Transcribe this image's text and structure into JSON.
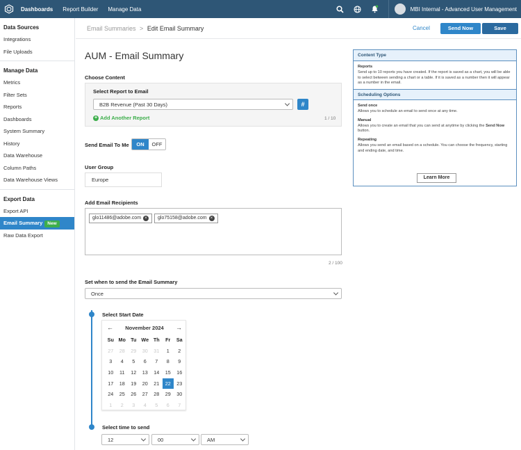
{
  "topbar": {
    "nav": [
      "Dashboards",
      "Report Builder",
      "Manage Data"
    ],
    "account_name": "MBI Internal - Advanced User Management"
  },
  "sidebar": {
    "section_data_sources": "Data Sources",
    "data_sources_items": [
      "Integrations",
      "File Uploads"
    ],
    "section_manage_data": "Manage Data",
    "manage_data_items": [
      "Metrics",
      "Filter Sets",
      "Reports",
      "Dashboards",
      "System Summary",
      "History",
      "Data Warehouse",
      "Column Paths",
      "Data Warehouse Views"
    ],
    "section_export_data": "Export Data",
    "export_data_items": [
      "Export API",
      "Email Summary",
      "Raw Data Export"
    ],
    "new_badge": "New"
  },
  "header": {
    "breadcrumb_parent": "Email Summaries",
    "breadcrumb_sep": ">",
    "breadcrumb_current": "Edit Email Summary",
    "cancel": "Cancel",
    "send_now": "Send Now",
    "save": "Save"
  },
  "form": {
    "title": "AUM - Email Summary",
    "choose_content": "Choose Content",
    "select_report_label": "Select Report to Email",
    "selected_report": "B2B Revenue (Past 30 Days)",
    "hash_button": "#",
    "add_another_report": "Add Another Report",
    "report_counter": "1 / 10",
    "send_email_to_me": "Send Email To Me",
    "toggle_on": "ON",
    "toggle_off": "OFF",
    "user_group_label": "User Group",
    "user_group_value": "Europe",
    "recipients_label": "Add Email Recipients",
    "recipients": [
      "glo11486@adobe.com",
      "glo75158@adobe.com"
    ],
    "recipients_counter": "2 / 100",
    "schedule_label": "Set when to send the Email Summary",
    "schedule_value": "Once",
    "start_date_label": "Select Start Date",
    "time_label": "Select time to send",
    "hour": "12",
    "minute": "00",
    "ampm": "AM"
  },
  "calendar": {
    "month": "November 2024",
    "prev": "←",
    "next": "→",
    "dow": [
      "Su",
      "Mo",
      "Tu",
      "We",
      "Th",
      "Fr",
      "Sa"
    ],
    "weeks": [
      [
        "27",
        "28",
        "29",
        "30",
        "31",
        "1",
        "2"
      ],
      [
        "3",
        "4",
        "5",
        "6",
        "7",
        "8",
        "9"
      ],
      [
        "10",
        "11",
        "12",
        "13",
        "14",
        "15",
        "16"
      ],
      [
        "17",
        "18",
        "19",
        "20",
        "21",
        "22",
        "23"
      ],
      [
        "24",
        "25",
        "26",
        "27",
        "28",
        "29",
        "30"
      ],
      [
        "1",
        "2",
        "3",
        "4",
        "5",
        "6",
        "7"
      ]
    ],
    "selected_day": "22"
  },
  "info": {
    "content_type_title": "Content Type",
    "reports_title": "Reports",
    "reports_text": "Send up to 10 reports you have created. If the report is saved as a chart, you will be able to select between sending a chart or a table. If it is saved as a number then it will appear as a number in the email.",
    "scheduling_title": "Scheduling Options",
    "send_once_title": "Send once",
    "send_once_text": "Allows you to schedule an email to send once at any time.",
    "manual_title": "Manual",
    "manual_text_1": "Allows you to create an email that you can send at anytime by clicking the",
    "manual_text_bold": "Send Now",
    "manual_text_2": "button.",
    "repeating_title": "Repeating",
    "repeating_text": "Allows you send an email based on a schedule. You can choose the frequency, starting and ending date, and time.",
    "learn_more": "Learn More"
  },
  "colors": {
    "topbar": "#2e5676",
    "accent": "#2f86c9",
    "new_badge": "#3dae4b"
  }
}
